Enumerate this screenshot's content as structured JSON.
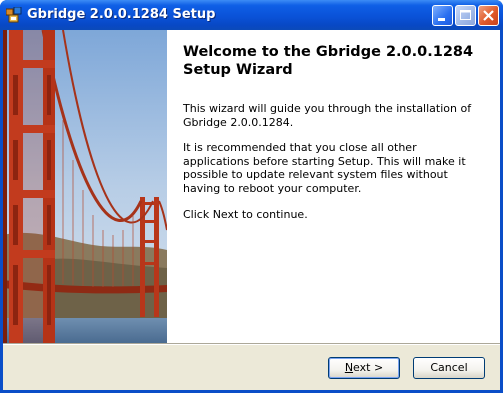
{
  "window": {
    "title": "Gbridge 2.0.0.1284 Setup",
    "controls": [
      "minimize-icon",
      "maximize-icon",
      "close-icon"
    ]
  },
  "wizard": {
    "heading": "Welcome to the Gbridge 2.0.0.1284 Setup Wizard",
    "paragraphs": [
      "This wizard will guide you through the installation of Gbridge 2.0.0.1284.",
      "It is recommended that you close all other applications before starting Setup. This will make it possible to update relevant system files without having to reboot your computer.",
      "Click Next to continue."
    ]
  },
  "buttons": {
    "next": {
      "mnemonic": "N",
      "rest": "ext >"
    },
    "cancel": "Cancel"
  },
  "colors": {
    "titlebar": "#0a52d8",
    "dialog_bg": "#ece9d8",
    "bridge": "#c23b1e"
  }
}
